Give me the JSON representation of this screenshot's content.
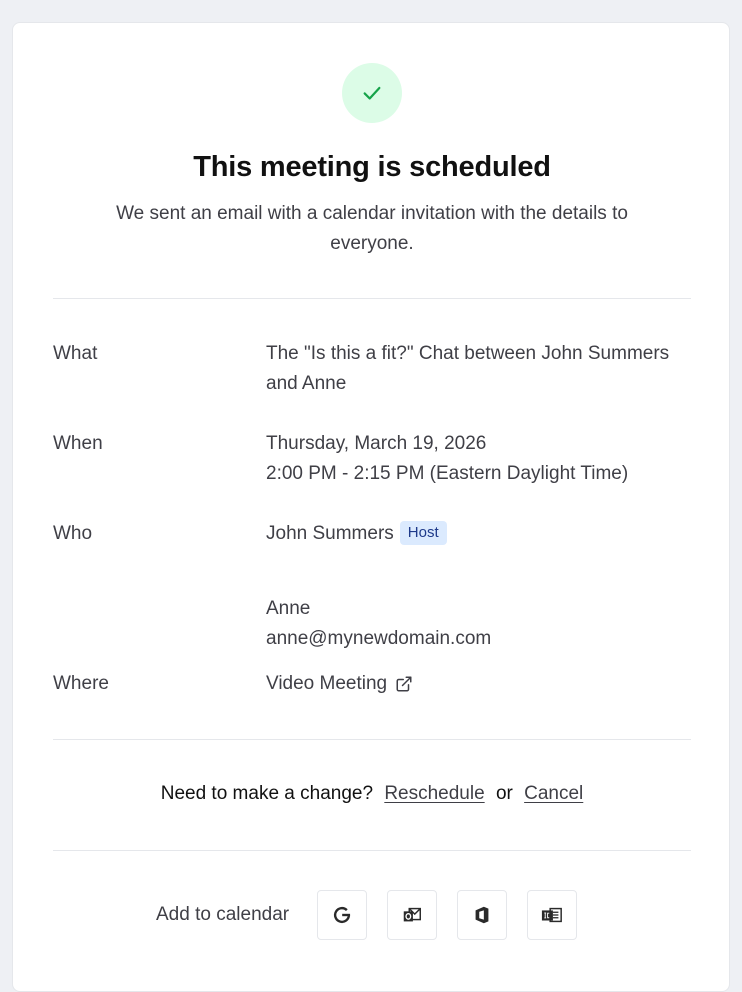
{
  "header": {
    "title": "This meeting is scheduled",
    "subtitle": "We sent an email with a calendar invitation with the details to everyone."
  },
  "details": {
    "what": {
      "label": "What",
      "value": "The \"Is this a fit?\" Chat between John Summers and Anne"
    },
    "when": {
      "label": "When",
      "date": "Thursday, March 19, 2026",
      "time": "2:00 PM - 2:15 PM (Eastern Daylight Time)"
    },
    "who": {
      "label": "Who",
      "host_name": "John Summers",
      "host_badge": "Host",
      "guest_name": "Anne",
      "guest_email": "anne@mynewdomain.com"
    },
    "where": {
      "label": "Where",
      "value": "Video Meeting"
    }
  },
  "change": {
    "prompt": "Need to make a change?",
    "reschedule_label": "Reschedule",
    "or_text": "or",
    "cancel_label": "Cancel"
  },
  "calendar": {
    "label": "Add to calendar",
    "icons": [
      "google-calendar-icon",
      "outlook-icon",
      "office365-icon",
      "ics-file-icon"
    ]
  },
  "colors": {
    "success_bg": "#dcfce7",
    "success_check": "#16a34a",
    "badge_bg": "#dbeafe",
    "badge_text": "#1e3a8a"
  }
}
